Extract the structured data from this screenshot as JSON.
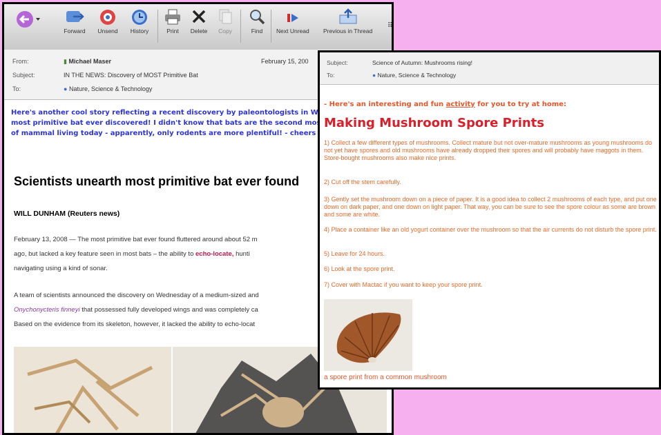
{
  "toolbar": {
    "items": [
      {
        "label": "",
        "icon": "back-icon"
      },
      {
        "label": "Forward",
        "icon": "forward-icon"
      },
      {
        "label": "Unsend",
        "icon": "unsend-icon"
      },
      {
        "label": "History",
        "icon": "history-icon"
      },
      {
        "label": "Print",
        "icon": "print-icon"
      },
      {
        "label": "Delete",
        "icon": "delete-icon"
      },
      {
        "label": "Copy",
        "icon": "copy-icon"
      },
      {
        "label": "Find",
        "icon": "find-icon"
      },
      {
        "label": "Next Unread",
        "icon": "next-unread-icon"
      },
      {
        "label": "Previous in Thread",
        "icon": "previous-thread-icon"
      }
    ]
  },
  "email1": {
    "from_label": "From:",
    "from_value": "Michael Maser",
    "date": "February 15, 200",
    "subject_label": "Subject:",
    "subject_value": "IN THE NEWS: Discovery of MOST Primitive Bat",
    "to_label": "To:",
    "to_value": "Nature, Science & Technology",
    "intro_line1": "Here's another cool story reflecting a recent discovery by paleontologists in Wy",
    "intro_line2": "most primitive bat ever discovered! I didn't know that bats are the second most",
    "intro_line3": "of mammal living today - apparently, only rodents are more plentiful!  - cheers",
    "headline": "Scientists unearth most primitive bat ever found",
    "byline": "WILL DUNHAM (Reuters news)",
    "para1_line1": "February 13, 2008 — The most primitive bat ever found fluttered around about 52 m",
    "para1_line2a": "ago, but lacked a key feature seen in most bats – the ability to ",
    "para1_link": "echo-locate,",
    "para1_line2b": " hunti",
    "para1_line3": "navigating using a kind of sonar.",
    "para2_line1": "A team of scientists announced the discovery on Wednesday of a medium-sized and",
    "para2_species": "Onychonycteris finneyi",
    "para2_line2b": " that possessed fully developed wings and was completely ca",
    "para2_line3": "Based on the evidence from its skeleton, however, it lacked the ability to echo-locat"
  },
  "email2": {
    "subject_label": "Subject:",
    "subject_value": "Science of Autumn:  Mushrooms rising!",
    "to_label": "To:",
    "to_value": "Nature, Science & Technology",
    "activity_pre": "- Here's an interesting and fun ",
    "activity_link": "activity",
    "activity_post": " for you to try at home:",
    "title": "Making Mushroom Spore Prints",
    "steps": [
      "1)      Collect a few different types of mushrooms.  Collect mature but not over-mature mushrooms as young mushrooms do not yet have spores and old mushrooms have already dropped their spores and will probably have maggots in them.  Store-bought mushrooms also make nice prints.",
      "2)      Cut off the stem carefully.",
      "3)      Gently set the mushroom down on a piece of paper.  It is a good idea to collect 2 mushrooms of each type, and put one down on dark paper, and one down on light paper.  That way, you can be sure to see the spore colour as some are brown and some are white.",
      "4)      Place a container like an old yogurt container over the mushroom so that the air currents do not disturb the spore print.",
      "5)      Leave for 24 hours.",
      "6)      Look at the spore print.",
      "7) Cover with Mactac if you want to keep your spore print."
    ],
    "caption": "a spore print from a common mushroom"
  }
}
